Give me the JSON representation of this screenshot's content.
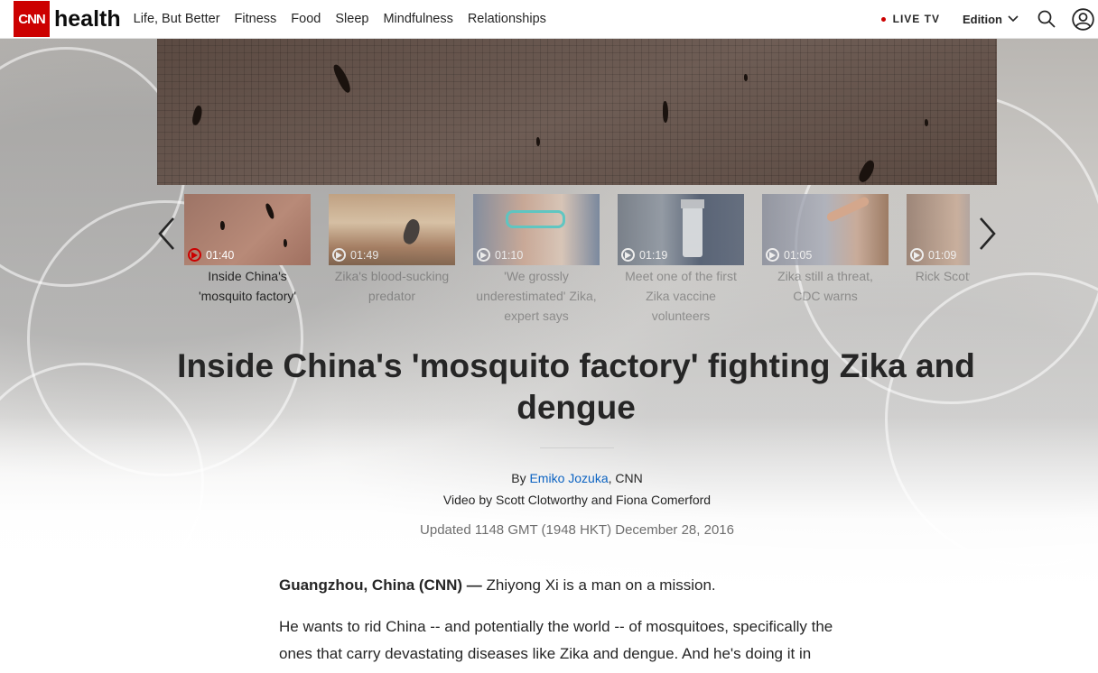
{
  "header": {
    "logo_cnn": "CNN",
    "logo_section": "health",
    "nav": [
      "Life, But Better",
      "Fitness",
      "Food",
      "Sleep",
      "Mindfulness",
      "Relationships"
    ],
    "live_tv": "LIVE TV",
    "edition": "Edition"
  },
  "carousel": {
    "items": [
      {
        "duration": "01:40",
        "caption": "Inside China's 'mosquito factory'",
        "active": true
      },
      {
        "duration": "01:49",
        "caption": "Zika's blood-sucking predator",
        "active": false
      },
      {
        "duration": "01:10",
        "caption": "'We grossly underestimated' Zika, expert says",
        "active": false
      },
      {
        "duration": "01:19",
        "caption": "Meet one of the first Zika vaccine volunteers",
        "active": false
      },
      {
        "duration": "01:05",
        "caption": "Zika still a threat, CDC warns",
        "active": false
      },
      {
        "duration": "01:09",
        "caption": "Rick Scott: Miami Z",
        "active": false
      }
    ]
  },
  "article": {
    "headline": "Inside China's 'mosquito factory' fighting Zika and dengue",
    "byline_prefix": "By ",
    "author": "Emiko Jozuka",
    "byline_suffix": ", CNN",
    "video_credit": "Video by Scott Clotworthy and Fiona Comerford",
    "updated": "Updated 1148 GMT (1948 HKT) December 28, 2016",
    "dateline": "Guangzhou, China (CNN) —",
    "lead": " Zhiyong Xi is a man on a mission.",
    "para2_line1": "He wants to rid China -- and potentially the world -- of mosquitoes, specifically the",
    "para2_line2": "ones that carry devastating diseases like Zika and dengue. And he's doing it in"
  },
  "colors": {
    "brand_red": "#cc0000",
    "link_blue": "#0c63c2",
    "text": "#262626"
  }
}
